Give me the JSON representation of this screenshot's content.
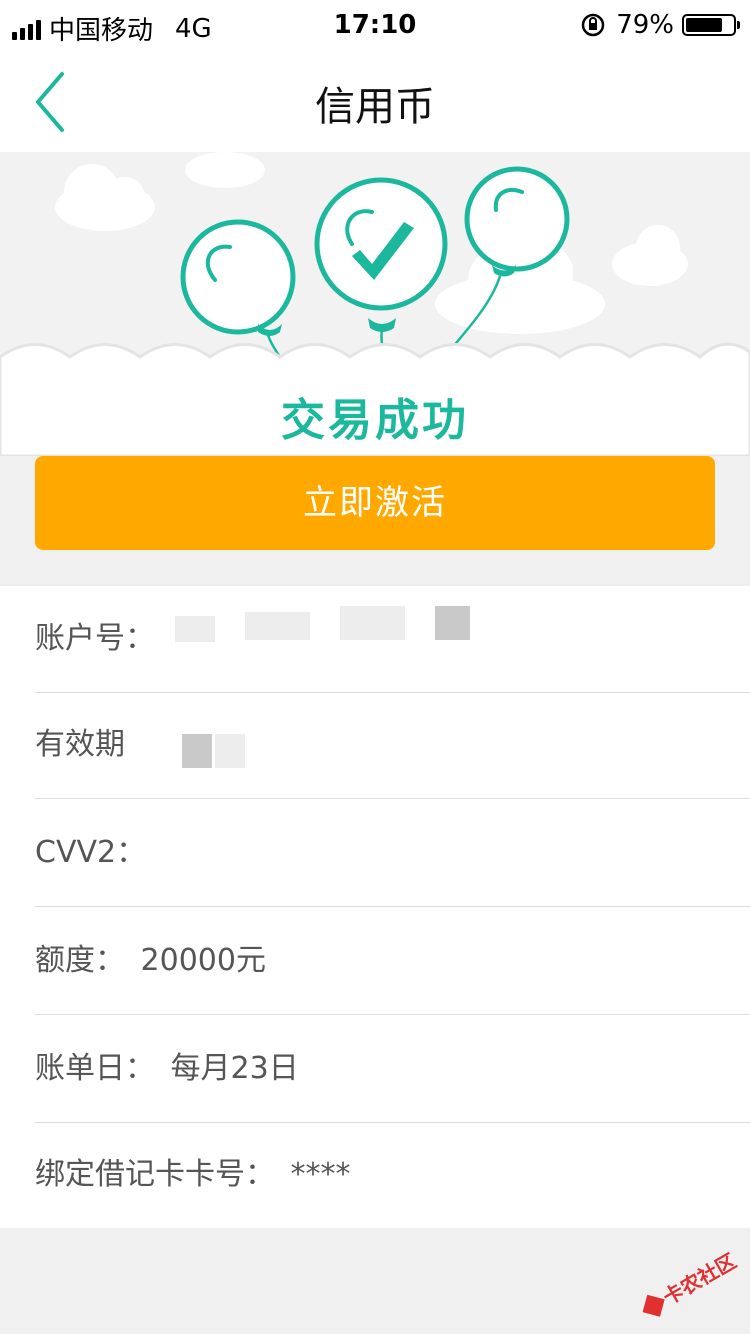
{
  "status_bar": {
    "carrier": "中国移动",
    "network": "4G",
    "time": "17:10",
    "battery": "79%",
    "battery_level": 0.79
  },
  "nav": {
    "title": "信用币"
  },
  "hero": {
    "title": "交易成功",
    "accent_color": "#1bb89e"
  },
  "actions": {
    "activate_label": "立即激活",
    "activate_color": "#ffa800"
  },
  "info": {
    "account_label": "账户号：",
    "account_value": "",
    "expiry_label": "有效期",
    "expiry_value": "",
    "cvv_label": "CVV2：",
    "cvv_value": "",
    "limit_label": "额度：",
    "limit_value": "20000元",
    "bill_day_label": "账单日：",
    "bill_day_value": "每月23日",
    "debit_card_label": "绑定借记卡卡号：",
    "debit_card_value": "****"
  },
  "watermark": {
    "text": "卡农社区"
  }
}
